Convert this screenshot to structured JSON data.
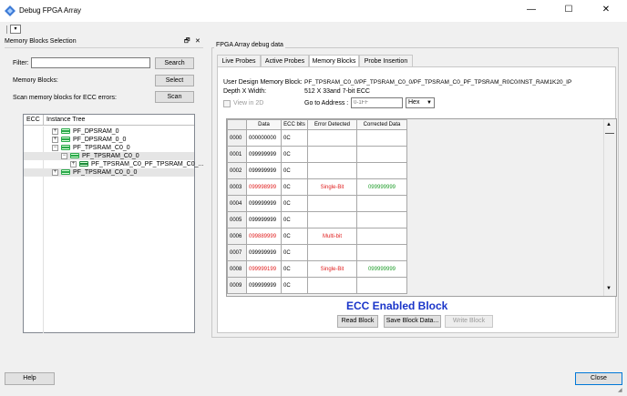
{
  "window": {
    "title": "Debug FPGA Array",
    "minimize": "—",
    "maximize": "☐",
    "close": "✕"
  },
  "toolbar": {
    "dropdown_glyph": "▾"
  },
  "left_panel": {
    "title": "Memory Blocks Selection",
    "float_glyph": "🗗",
    "close_glyph": "✕",
    "filter_label": "Filter:",
    "filter_value": "",
    "search_button": "Search",
    "memory_blocks_label": "Memory Blocks:",
    "select_button": "Select",
    "scan_label": "Scan memory blocks for ECC errors:",
    "scan_button": "Scan",
    "tree": {
      "col_ecc": "ECC",
      "col_instance": "Instance Tree",
      "items": [
        {
          "label": "PF_DPSRAM_0",
          "expander": "+"
        },
        {
          "label": "PF_DPSRAM_0_0",
          "expander": "+"
        },
        {
          "label": "PF_TPSRAM_C0_0",
          "expander": "−"
        },
        {
          "label": "PF_TPSRAM_C0_0",
          "expander": "−"
        },
        {
          "label": "PF_TPSRAM_C0_PF_TPSRAM_C0_...",
          "expander": "+"
        },
        {
          "label": "PF_TPSRAM_C0_0_0",
          "expander": "+"
        }
      ]
    }
  },
  "right_panel": {
    "group_title": "FPGA Array debug data",
    "tabs": [
      "Live Probes",
      "Active Probes",
      "Memory Blocks",
      "Probe Insertion"
    ],
    "active_tab": "Memory Blocks",
    "user_design_label": "User Design Memory Block:",
    "user_design_value": "PF_TPSRAM_C0_0/PF_TPSRAM_C0_0/PF_TPSRAM_C0_PF_TPSRAM_R0C0/INST_RAM1K20_IP",
    "depth_label": "Depth X Width:",
    "depth_value": "512 X 33and 7-bit ECC",
    "view2d_label": "View in 2D",
    "goto_label": "Go to Address :",
    "goto_placeholder": "0-1FF",
    "radix_value": "Hex",
    "grid": {
      "headers": [
        "Data",
        "ECC bits",
        "Error Detected",
        "Corrected Data"
      ],
      "rows": [
        {
          "addr": "0000",
          "data": "000000000",
          "ecc": "0C",
          "error": "",
          "corrected": "",
          "flag": false
        },
        {
          "addr": "0001",
          "data": "099999999",
          "ecc": "0C",
          "error": "",
          "corrected": "",
          "flag": false
        },
        {
          "addr": "0002",
          "data": "099999999",
          "ecc": "0C",
          "error": "",
          "corrected": "",
          "flag": false
        },
        {
          "addr": "0003",
          "data": "099998999",
          "ecc": "0C",
          "error": "Single-Bit",
          "corrected": "099999999",
          "flag": true
        },
        {
          "addr": "0004",
          "data": "099999999",
          "ecc": "0C",
          "error": "",
          "corrected": "",
          "flag": false
        },
        {
          "addr": "0005",
          "data": "099999999",
          "ecc": "0C",
          "error": "",
          "corrected": "",
          "flag": false
        },
        {
          "addr": "0006",
          "data": "099889999",
          "ecc": "0C",
          "error": "Multi-bit",
          "corrected": "",
          "flag": true
        },
        {
          "addr": "0007",
          "data": "099999999",
          "ecc": "0C",
          "error": "",
          "corrected": "",
          "flag": false
        },
        {
          "addr": "0008",
          "data": "099999199",
          "ecc": "0C",
          "error": "Single-Bit",
          "corrected": "099999999",
          "flag": true
        },
        {
          "addr": "0009",
          "data": "099999999",
          "ecc": "0C",
          "error": "",
          "corrected": "",
          "flag": false
        }
      ]
    },
    "ecc_banner": "ECC Enabled Block",
    "read_block": "Read Block",
    "save_block": "Save Block Data...",
    "write_block": "Write Block"
  },
  "footer": {
    "help": "Help",
    "close": "Close"
  },
  "colors": {
    "error_text": "#e02020",
    "corrected_text": "#1f9d2a",
    "banner": "#1a35c9"
  }
}
